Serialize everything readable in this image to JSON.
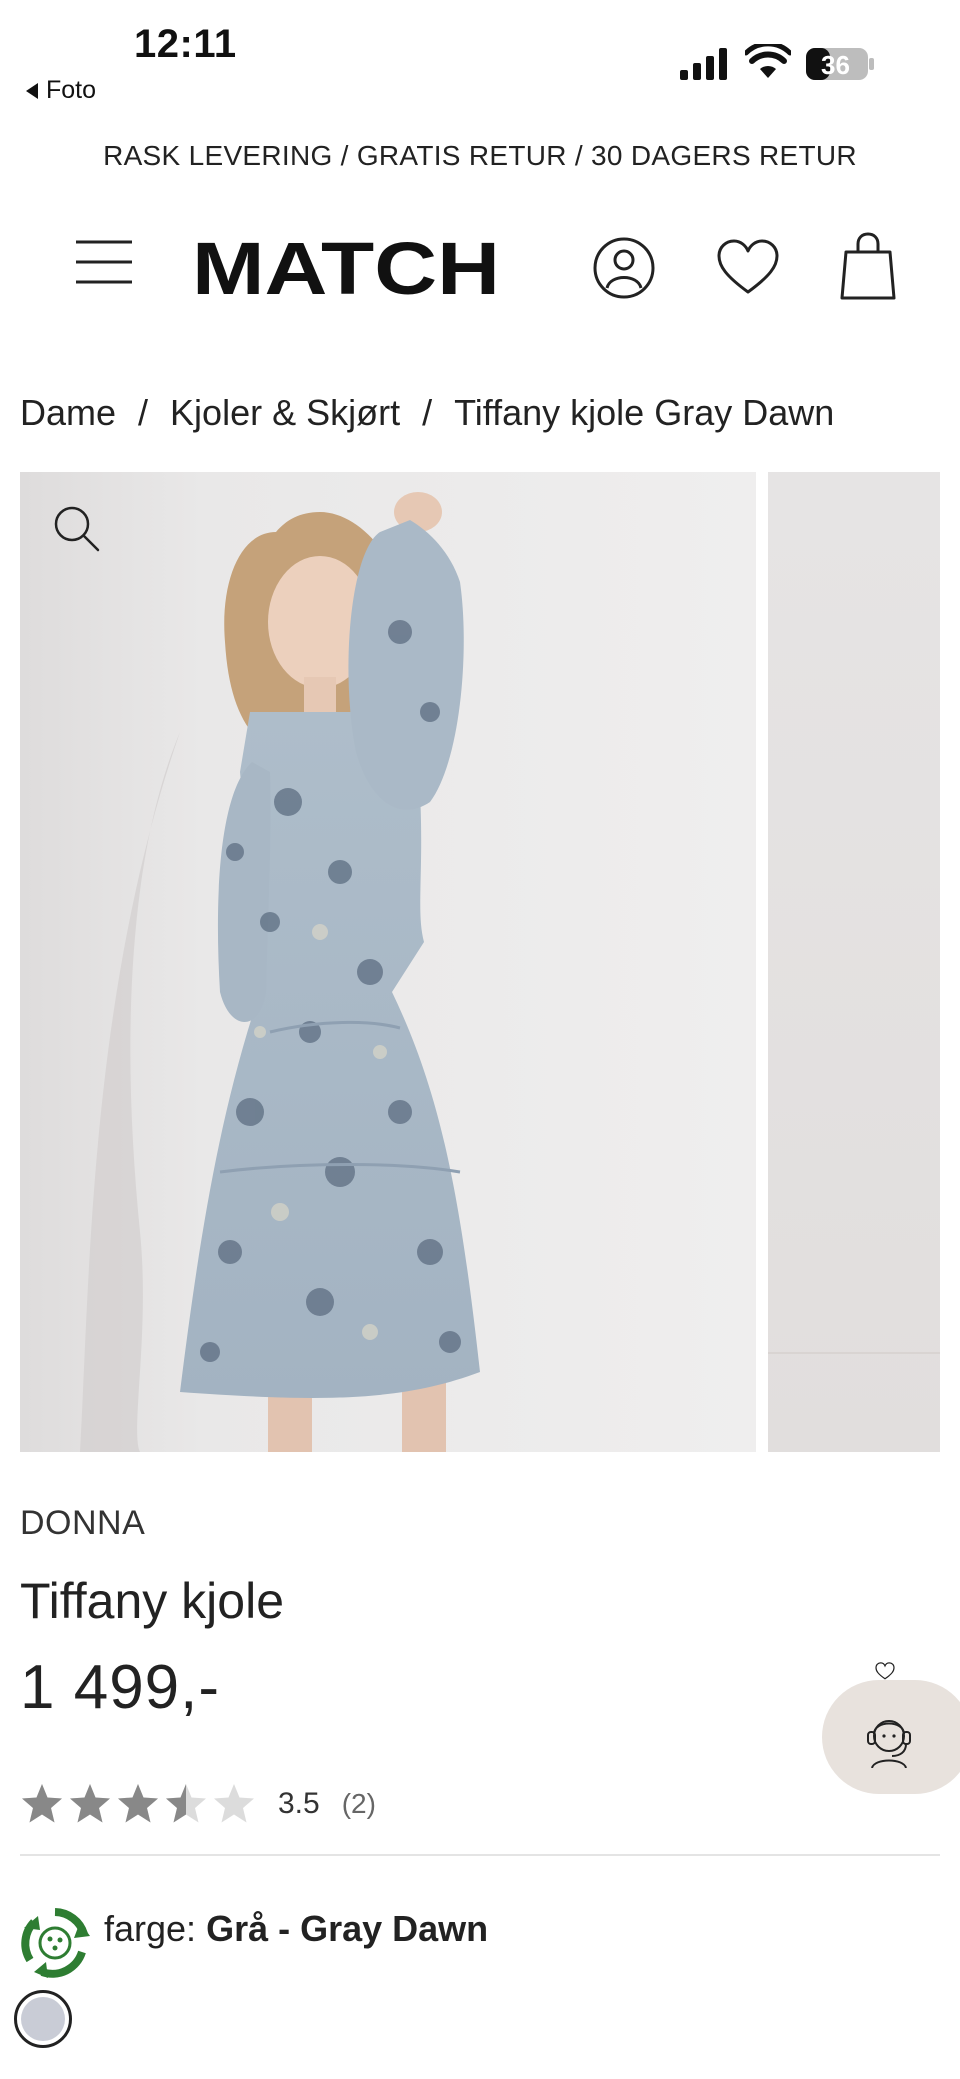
{
  "status_bar": {
    "time": "12:11",
    "back_label": "Foto",
    "battery": "36"
  },
  "promo_banner": "RASK LEVERING / GRATIS RETUR / 30 DAGERS RETUR",
  "header": {
    "logo": "MATCH",
    "icons": [
      "menu-icon",
      "user-icon",
      "heart-icon",
      "shopping-bag-icon"
    ]
  },
  "breadcrumb": {
    "items": [
      "Dame",
      "Kjoler & Skjørt",
      "Tiffany kjole Gray Dawn"
    ],
    "separator": "/"
  },
  "product": {
    "brand": "DONNA",
    "name": "Tiffany kjole",
    "price": "1 499,-",
    "rating": {
      "value": "3.5",
      "count": "(2)",
      "stars_max": 5,
      "stars_filled": 3.5,
      "star_color": "#888888",
      "star_empty_color": "#dcdcdc"
    },
    "color": {
      "label": "farge:",
      "value": "Grå - Gray Dawn",
      "swatch_hex": "#c9ccd6"
    }
  },
  "colors": {
    "dress": "#a9b8c6",
    "eco_green": "#2e7d32",
    "chat_bg": "#e8e2dd"
  }
}
